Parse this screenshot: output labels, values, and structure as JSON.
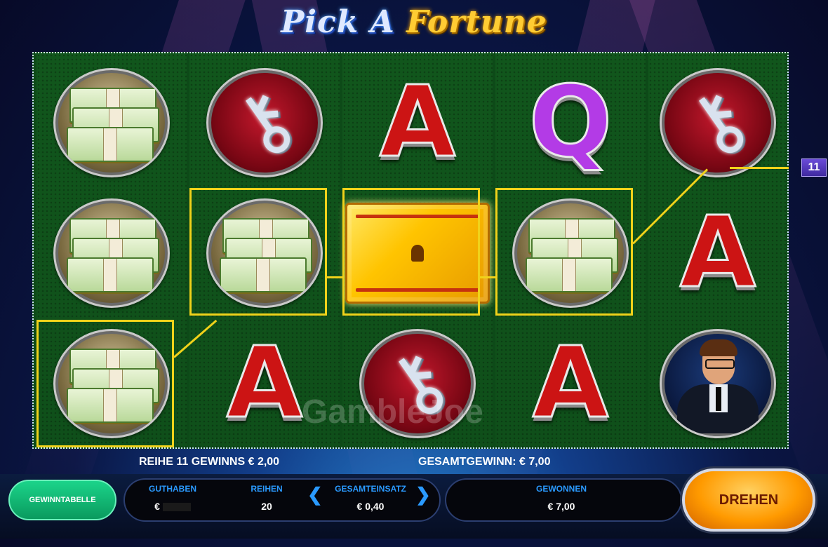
{
  "game": {
    "title_part1": "Pick A",
    "title_part2": "Fortune"
  },
  "reels": [
    [
      "money-stack",
      "money-stack",
      "money-stack"
    ],
    [
      "silver-key",
      "money-stack",
      "letter-a"
    ],
    [
      "letter-a",
      "golden-safe",
      "silver-key"
    ],
    [
      "letter-q",
      "money-stack",
      "letter-a"
    ],
    [
      "silver-key",
      "letter-a",
      "host"
    ]
  ],
  "symbol_text": {
    "letter_a": "A",
    "letter_q": "Q"
  },
  "win_line": {
    "row_marker": "11",
    "cells": [
      "reel1-row3",
      "reel2-row2",
      "reel3-row2",
      "reel4-row2"
    ]
  },
  "watermark": "GambleJoe",
  "status": {
    "line_win": "REIHE 11 GEWINNS € 2,00",
    "total_win": "GESAMTGEWINN: € 7,00"
  },
  "controls": {
    "paytable_button": "GEWINNTABELLE",
    "balance_label": "GUTHABEN",
    "balance_value": "€",
    "lines_label": "REIHEN",
    "lines_value": "20",
    "total_bet_label": "GESAMTEINSATZ",
    "total_bet_value": "€ 0,40",
    "won_label": "GEWONNEN",
    "won_value": "€ 7,00",
    "spin_button": "DREHEN",
    "arrow_left": "❮",
    "arrow_right": "❯"
  },
  "colors": {
    "win_frame": "#f0d21a",
    "spin_button": "#ff9a00",
    "paytable_button": "#1bd48a",
    "letter_a": "#cc1414",
    "letter_q": "#b33be6",
    "label_blue": "#2a9aff"
  }
}
